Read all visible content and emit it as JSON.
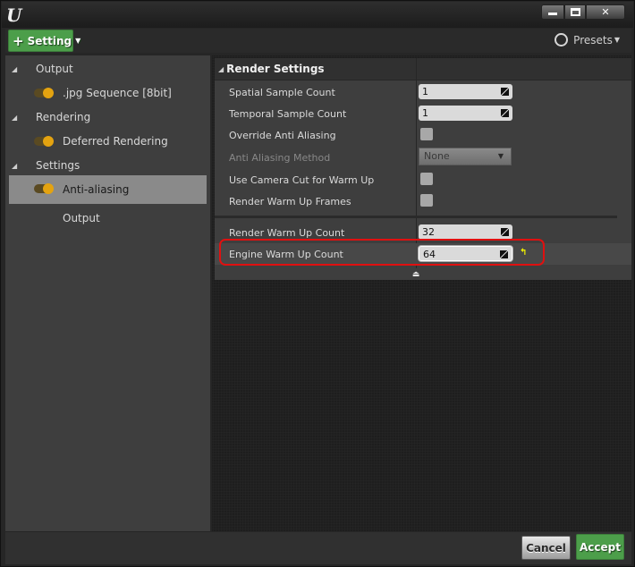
{
  "window": {
    "logo": "U",
    "controls": {
      "minimize": "minimize",
      "maximize": "maximize",
      "close": "close"
    }
  },
  "toolbar": {
    "add_setting_label": "Setting",
    "presets_label": "Presets"
  },
  "sidebar": {
    "groups": [
      {
        "label": "Output",
        "items": [
          {
            "label": ".jpg Sequence [8bit]",
            "enabled": true,
            "selected": false
          }
        ]
      },
      {
        "label": "Rendering",
        "items": [
          {
            "label": "Deferred Rendering",
            "enabled": true,
            "selected": false
          }
        ]
      },
      {
        "label": "Settings",
        "items": [
          {
            "label": "Anti-aliasing",
            "enabled": true,
            "selected": true
          },
          {
            "label": "Output",
            "enabled": null,
            "selected": false
          }
        ]
      }
    ]
  },
  "details": {
    "category": "Render Settings",
    "properties": [
      {
        "name": "Spatial Sample Count",
        "type": "number",
        "value": "1"
      },
      {
        "name": "Temporal Sample Count",
        "type": "number",
        "value": "1"
      },
      {
        "name": "Override Anti Aliasing",
        "type": "checkbox",
        "value": false
      },
      {
        "name": "Anti Aliasing Method",
        "type": "dropdown",
        "value": "None",
        "disabled": true
      },
      {
        "name": "Use Camera Cut for Warm Up",
        "type": "checkbox",
        "value": false
      },
      {
        "name": "Render Warm Up Frames",
        "type": "checkbox",
        "value": false
      }
    ],
    "advanced_properties": [
      {
        "name": "Render Warm Up Count",
        "type": "number",
        "value": "32"
      },
      {
        "name": "Engine Warm Up Count",
        "type": "number",
        "value": "64",
        "modified": true,
        "highlighted": true
      }
    ]
  },
  "footer": {
    "cancel_label": "Cancel",
    "accept_label": "Accept"
  },
  "colors": {
    "accent_green": "#4c9e4a",
    "toggle_on": "#e4a310",
    "highlight_red": "#e01010",
    "reset_yellow": "#f2f200"
  }
}
